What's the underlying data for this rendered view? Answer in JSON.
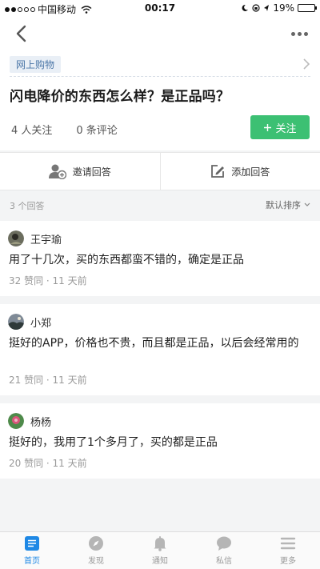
{
  "status_bar": {
    "carrier": "中国移动",
    "time": "00:17",
    "battery": "19%",
    "battery_level": 0.19
  },
  "question": {
    "topic": "网上购物",
    "title": "闪电降价的东西怎么样？是正品吗？",
    "followers": "4 人关注",
    "comments": "0 条评论",
    "follow_label": "关注"
  },
  "actions": {
    "invite": "邀请回答",
    "add": "添加回答"
  },
  "answers_bar": {
    "count": "3 个回答",
    "sort": "默认排序"
  },
  "answers": [
    {
      "author": "王宇瑜",
      "text": "用了十几次，买的东西都蛮不错的，确定是正品",
      "likes": "32 赞同",
      "time": "11 天前"
    },
    {
      "author": "小郑",
      "text": "挺好的APP，价格也不贵，而且都是正品，以后会经常用的",
      "likes": "21 赞同",
      "time": "11 天前"
    },
    {
      "author": "杨杨",
      "text": "挺好的，我用了1个多月了，买的都是正品",
      "likes": "20 赞同",
      "time": "11 天前"
    }
  ],
  "tabs": [
    {
      "label": "首页",
      "icon": "home-icon",
      "active": true
    },
    {
      "label": "发现",
      "icon": "compass-icon",
      "active": false
    },
    {
      "label": "通知",
      "icon": "bell-icon",
      "active": false
    },
    {
      "label": "私信",
      "icon": "message-icon",
      "active": false
    },
    {
      "label": "更多",
      "icon": "menu-icon",
      "active": false
    }
  ],
  "colors": {
    "accent": "#3cc073",
    "tab_active": "#1e88e5",
    "topic_bg": "#e9eff6",
    "topic_text": "#4c77a8"
  }
}
